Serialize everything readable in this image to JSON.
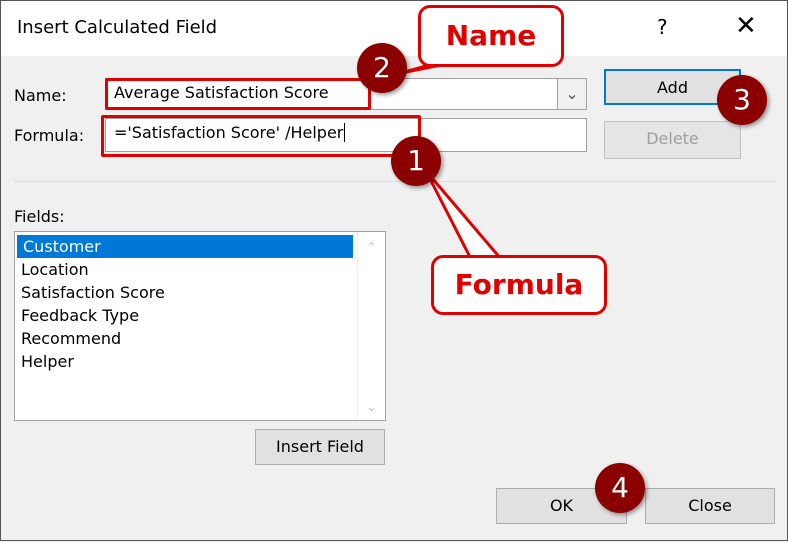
{
  "dialog": {
    "title": "Insert Calculated Field",
    "help": "?",
    "close": "✕"
  },
  "name_label": "Name:",
  "formula_label": "Formula:",
  "name_value": "Average Satisfaction Score",
  "formula_value": "='Satisfaction Score' /Helper",
  "buttons": {
    "add": "Add",
    "delete": "Delete",
    "insert_field": "Insert Field",
    "ok": "OK",
    "close": "Close"
  },
  "fields_label": "Fields:",
  "fields": [
    "Customer",
    "Location",
    "Satisfaction Score",
    "Feedback Type",
    "Recommend",
    "Helper"
  ],
  "annotations": {
    "name_callout": "Name",
    "formula_callout": "Formula",
    "steps": [
      "1",
      "2",
      "3",
      "4"
    ]
  },
  "colors": {
    "accent": "#0078d7",
    "annotation_red": "#e00000",
    "badge": "#8b0000"
  }
}
